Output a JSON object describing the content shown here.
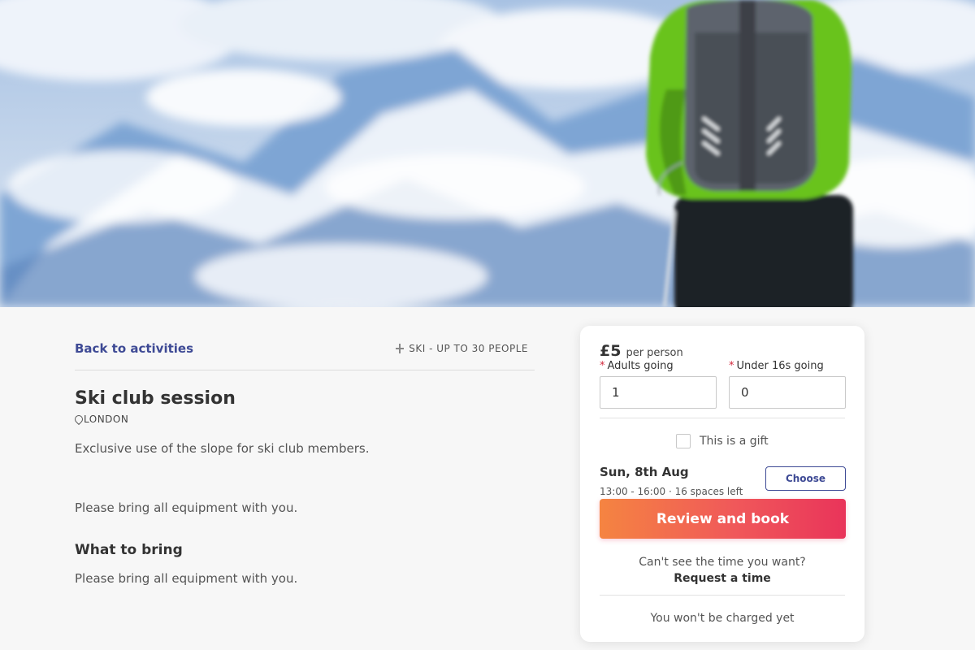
{
  "hero": {
    "image": "skier-mountain-photo"
  },
  "nav": {
    "back_label": "Back to activities"
  },
  "activity": {
    "meta_icon": "ski-icon",
    "meta_label": "SKI - UP TO 30 PEOPLE",
    "title": "Ski club session",
    "location_icon": "map-pin-icon",
    "location": "LONDON",
    "description": "Exclusive use of the slope for ski club members.",
    "note": "Please bring all equipment with you.",
    "what_to_bring_heading": "What to bring",
    "what_to_bring_body": "Please bring all equipment with you."
  },
  "booking": {
    "price": "£5",
    "price_unit": "per person",
    "adults_label": "Adults going",
    "adults_value": "1",
    "under16_label": "Under 16s going",
    "under16_value": "0",
    "required_marker": "*",
    "gift_label": "This is a gift",
    "gift_checked": false,
    "date": "Sun, 8th Aug",
    "slot": "13:00 - 16:00 · 16 spaces left",
    "choose_label": "Choose",
    "book_label": "Review and book",
    "cant_see_text": "Can't see the time you want?",
    "request_label": "Request a time",
    "charge_notice": "You won't be charged yet"
  },
  "colors": {
    "accent": "#3e4a95",
    "cta_start": "#f58441",
    "cta_end": "#e9345a",
    "required": "#d2283c"
  }
}
